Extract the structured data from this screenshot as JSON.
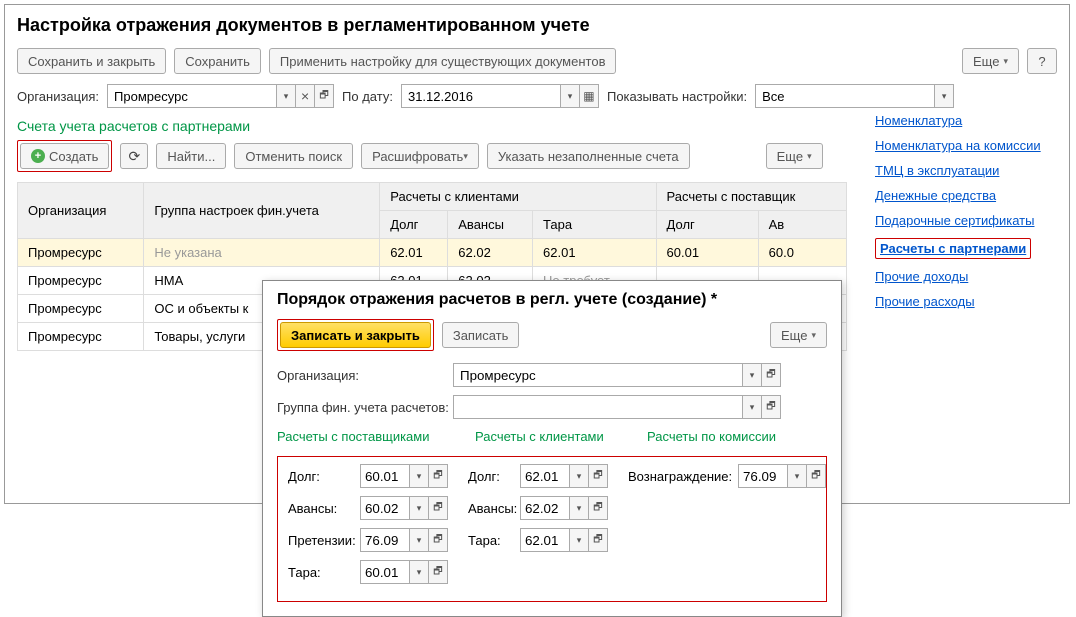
{
  "main": {
    "title": "Настройка отражения документов в регламентированном учете",
    "save_close": "Сохранить и закрыть",
    "save": "Сохранить",
    "apply": "Применить настройку для существующих документов",
    "more": "Еще",
    "help": "?",
    "org_label": "Организация:",
    "org_value": "Промресурс",
    "date_label": "По дату:",
    "date_value": "31.12.2016",
    "show_label": "Показывать настройки:",
    "show_value": "Все"
  },
  "section": {
    "title": "Счета учета расчетов с партнерами",
    "create": "Создать",
    "find": "Найти...",
    "cancel_search": "Отменить поиск",
    "decode": "Расшифровать",
    "unfilled": "Указать незаполненные счета",
    "more": "Еще"
  },
  "grid": {
    "h_org": "Организация",
    "h_group": "Группа настроек фин.учета",
    "h_clients": "Расчеты с клиентами",
    "h_suppliers": "Расчеты с поставщик",
    "h_debt": "Долг",
    "h_advance": "Авансы",
    "h_tara": "Тара",
    "h_debt2": "Долг",
    "h_adv2": "Ав",
    "rows": [
      {
        "org": "Промресурс",
        "group": "Не указана",
        "debt": "62.01",
        "adv": "62.02",
        "tara": "62.01",
        "sdebt": "60.01",
        "sadv": "60.0"
      },
      {
        "org": "Промресурс",
        "group": "НМА",
        "debt": "62.01",
        "adv": "62.02",
        "tara": "Не требует...",
        "sdebt": "",
        "sadv": ""
      },
      {
        "org": "Промресурс",
        "group": "ОС и объекты к",
        "debt": "",
        "adv": "",
        "tara": "",
        "sdebt": "",
        "sadv": ""
      },
      {
        "org": "Промресурс",
        "group": "Товары, услуги",
        "debt": "",
        "adv": "",
        "tara": "",
        "sdebt": "",
        "sadv": ""
      }
    ]
  },
  "sidebar": {
    "items": [
      "Номенклатура",
      "Номенклатура на комиссии",
      "ТМЦ в эксплуатации",
      "Денежные средства",
      "Подарочные сертификаты",
      "Расчеты с партнерами",
      "Прочие доходы",
      "Прочие расходы"
    ]
  },
  "dialog": {
    "title": "Порядок отражения расчетов в регл. учете (создание) *",
    "write_close": "Записать и закрыть",
    "write": "Записать",
    "more": "Еще",
    "org_label": "Организация:",
    "org_value": "Промресурс",
    "group_label": "Группа фин. учета расчетов:",
    "group_value": "",
    "col_suppliers": "Расчеты с поставщиками",
    "col_clients": "Расчеты с клиентами",
    "col_commission": "Расчеты по комиссии",
    "l_debt": "Долг:",
    "l_advance": "Авансы:",
    "l_claims": "Претензии:",
    "l_tara": "Тара:",
    "l_reward": "Вознаграждение:",
    "suppliers": {
      "debt": "60.01",
      "advance": "60.02",
      "claims": "76.09",
      "tara": "60.01"
    },
    "clients": {
      "debt": "62.01",
      "advance": "62.02",
      "tara": "62.01"
    },
    "commission": {
      "reward": "76.09"
    }
  }
}
